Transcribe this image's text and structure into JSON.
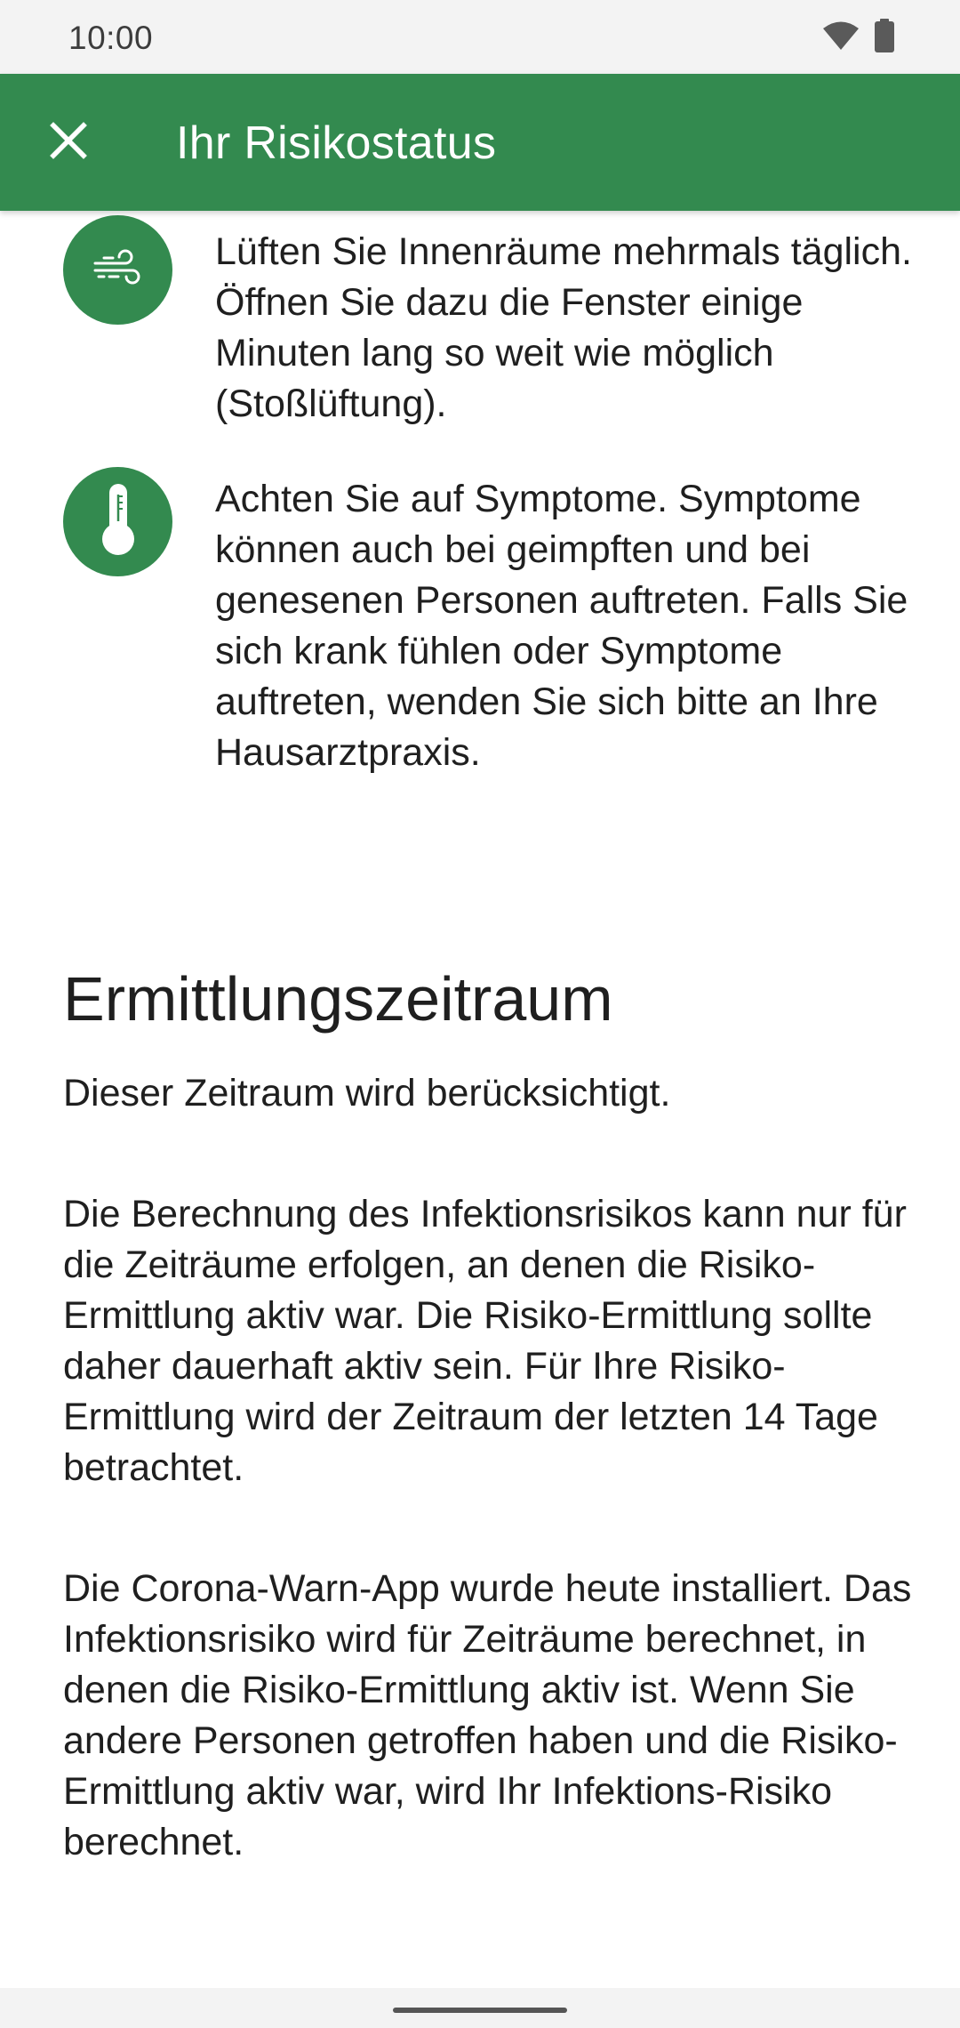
{
  "status_bar": {
    "time": "10:00",
    "icons": [
      "wifi-icon",
      "battery-icon"
    ]
  },
  "app_bar": {
    "title": "Ihr Risikostatus",
    "close_icon": "close-icon"
  },
  "tips": [
    {
      "icon": "wind-icon",
      "text": "Lüften Sie Innenräume mehrmals täglich. Öffnen Sie dazu die Fenster einige Minuten lang so weit wie möglich (Stoßlüftung)."
    },
    {
      "icon": "thermometer-icon",
      "text": "Achten Sie auf Symptome. Symptome können auch bei geimpften und bei genesenen Personen auftreten. Falls Sie sich krank fühlen oder Symptome auftreten, wenden Sie sich bitte an Ihre Hausarztpraxis."
    }
  ],
  "section": {
    "title": "Ermittlungszeitraum",
    "subtitle": "Dieser Zeitraum wird berücksichtigt.",
    "paragraphs": [
      "Die Berechnung des Infektionsrisikos kann nur für die Zeiträume erfolgen, an denen die Risiko-Ermittlung aktiv war. Die Risiko-Ermittlung sollte daher dauerhaft aktiv sein. Für Ihre Risiko-Ermittlung wird der Zeitraum der letzten 14 Tage betrachtet.",
      "Die Corona-Warn-App wurde heute installiert. Das Infektionsrisiko wird für Zeiträume berechnet, in denen die Risiko-Ermittlung aktiv ist. Wenn Sie andere Personen getroffen haben und die Risiko-Ermittlung aktiv war, wird Ihr Infektions-Risiko berechnet."
    ]
  },
  "colors": {
    "primary": "#338a4f",
    "status_bar_bg": "#f3f3f3",
    "text": "#1f1f1f"
  }
}
